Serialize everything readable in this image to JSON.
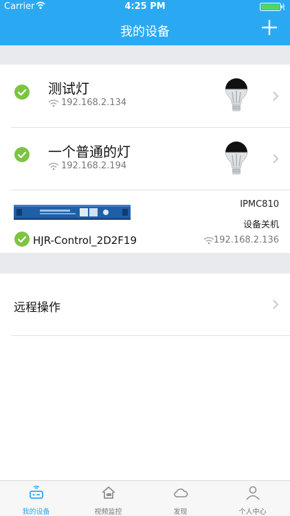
{
  "status_bar": {
    "carrier": "Carrier",
    "time": "4:25 PM"
  },
  "nav": {
    "title": "我的设备"
  },
  "devices": [
    {
      "name": "测试灯",
      "ip": "192.168.2.134"
    },
    {
      "name": "一个普通的灯",
      "ip": "192.168.2.194"
    }
  ],
  "controller": {
    "model": "IPMC810",
    "action": "设备关机",
    "name": "HJR-Control_2D2F19",
    "ip": "192.168.2.136"
  },
  "remote": {
    "label": "远程操作"
  },
  "tabs": [
    {
      "label": "我的设备",
      "icon": "router-icon"
    },
    {
      "label": "视频监控",
      "icon": "camera-house-icon"
    },
    {
      "label": "发现",
      "icon": "cloud-icon"
    },
    {
      "label": "个人中心",
      "icon": "person-icon"
    }
  ],
  "colors": {
    "accent": "#2aa9f2",
    "check": "#7cc442",
    "background_gap": "#e9eaee"
  }
}
